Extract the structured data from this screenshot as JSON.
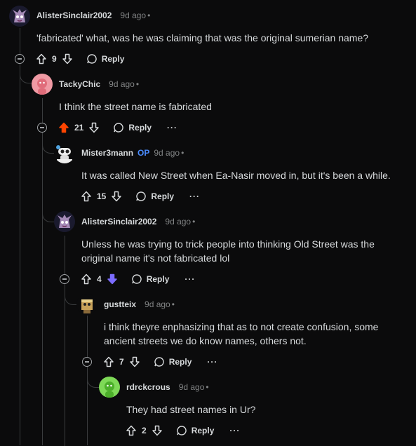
{
  "comments": [
    {
      "author": "AlisterSinclair2002",
      "op": "",
      "time": "9d ago",
      "text": "'fabricated' what, was he was claiming that was the original sumerian name?",
      "score": "9",
      "reply": "Reply",
      "vote": "none"
    },
    {
      "author": "TackyChic",
      "op": "",
      "time": "9d ago",
      "text": "I think the street name is fabricated",
      "score": "21",
      "reply": "Reply",
      "vote": "up"
    },
    {
      "author": "Mister3mann",
      "op": "OP",
      "time": "9d ago",
      "text": "It was called New Street when Ea-Nasir moved in, but it's been a while.",
      "score": "15",
      "reply": "Reply",
      "vote": "none"
    },
    {
      "author": "AlisterSinclair2002",
      "op": "",
      "time": "9d ago",
      "text": "Unless he was trying to trick people into thinking Old Street was the original name it's not fabricated lol",
      "score": "4",
      "reply": "Reply",
      "vote": "down"
    },
    {
      "author": "gustteix",
      "op": "",
      "time": "9d ago",
      "text": "i think theyre enphasizing that as to not create confusion, some ancient streets we do know names, others not.",
      "score": "7",
      "reply": "Reply",
      "vote": "none"
    },
    {
      "author": "rdrckcrous",
      "op": "",
      "time": "9d ago",
      "text": "They had street names in Ur?",
      "score": "2",
      "reply": "Reply",
      "vote": "none"
    }
  ],
  "colors": {
    "upvoted": "#ff4500",
    "downvoted": "#7c6cff",
    "op": "#4a8cff"
  },
  "icons": [
    "upvote-icon",
    "downvote-icon",
    "reply-icon",
    "more-icon",
    "collapse-icon"
  ]
}
